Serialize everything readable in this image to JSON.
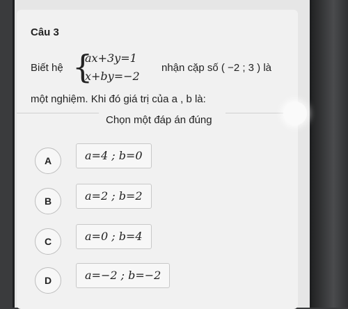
{
  "question": {
    "title": "Câu 3",
    "lead": "Biết hệ",
    "system": [
      "ax+3y=1",
      "x+by=−2"
    ],
    "tail": "nhận cặp số ( −2 ; 3 ) là",
    "line2": "một nghiệm. Khi đó giá trị của a , b là:"
  },
  "instruction": "Chọn một đáp án đúng",
  "options": [
    {
      "letter": "A",
      "text": "a=4 ; b=0"
    },
    {
      "letter": "B",
      "text": "a=2 ; b=2"
    },
    {
      "letter": "C",
      "text": "a=0 ; b=4"
    },
    {
      "letter": "D",
      "text": "a=−2 ; b=−2"
    }
  ],
  "colors": {
    "card": "#f1f1f1",
    "text": "#222222",
    "border": "#c8c8c8"
  }
}
